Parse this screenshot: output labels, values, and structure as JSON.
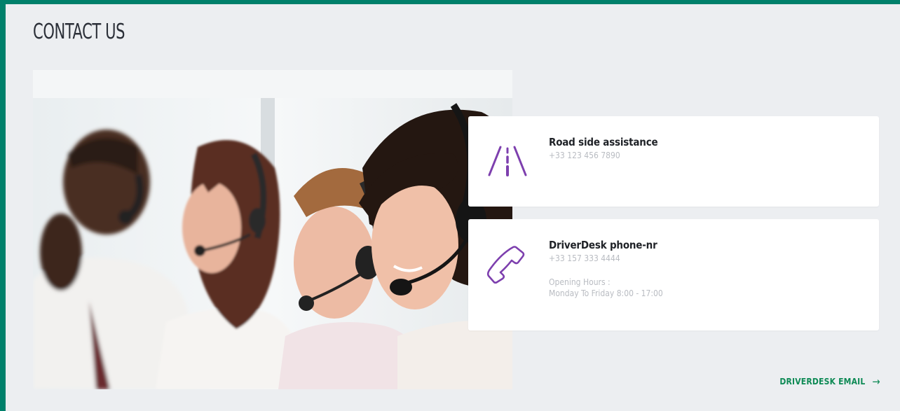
{
  "page": {
    "title": "CONTACT US"
  },
  "cards": [
    {
      "title": "Road side assistance",
      "phone": "+33 123 456 7890",
      "icon": "road-icon"
    },
    {
      "title": "DriverDesk phone-nr",
      "phone": "+33 157 333 4444",
      "hours_label": "Opening Hours :",
      "hours": "Monday To Friday 8:00 - 17:00",
      "icon": "phone-icon"
    }
  ],
  "email_link": {
    "label": "DRIVERDESK EMAIL",
    "arrow": "→"
  },
  "colors": {
    "frame": "#00806b",
    "accent_icon": "#7d3fae",
    "link": "#0e8a55",
    "background": "#eceef1"
  }
}
